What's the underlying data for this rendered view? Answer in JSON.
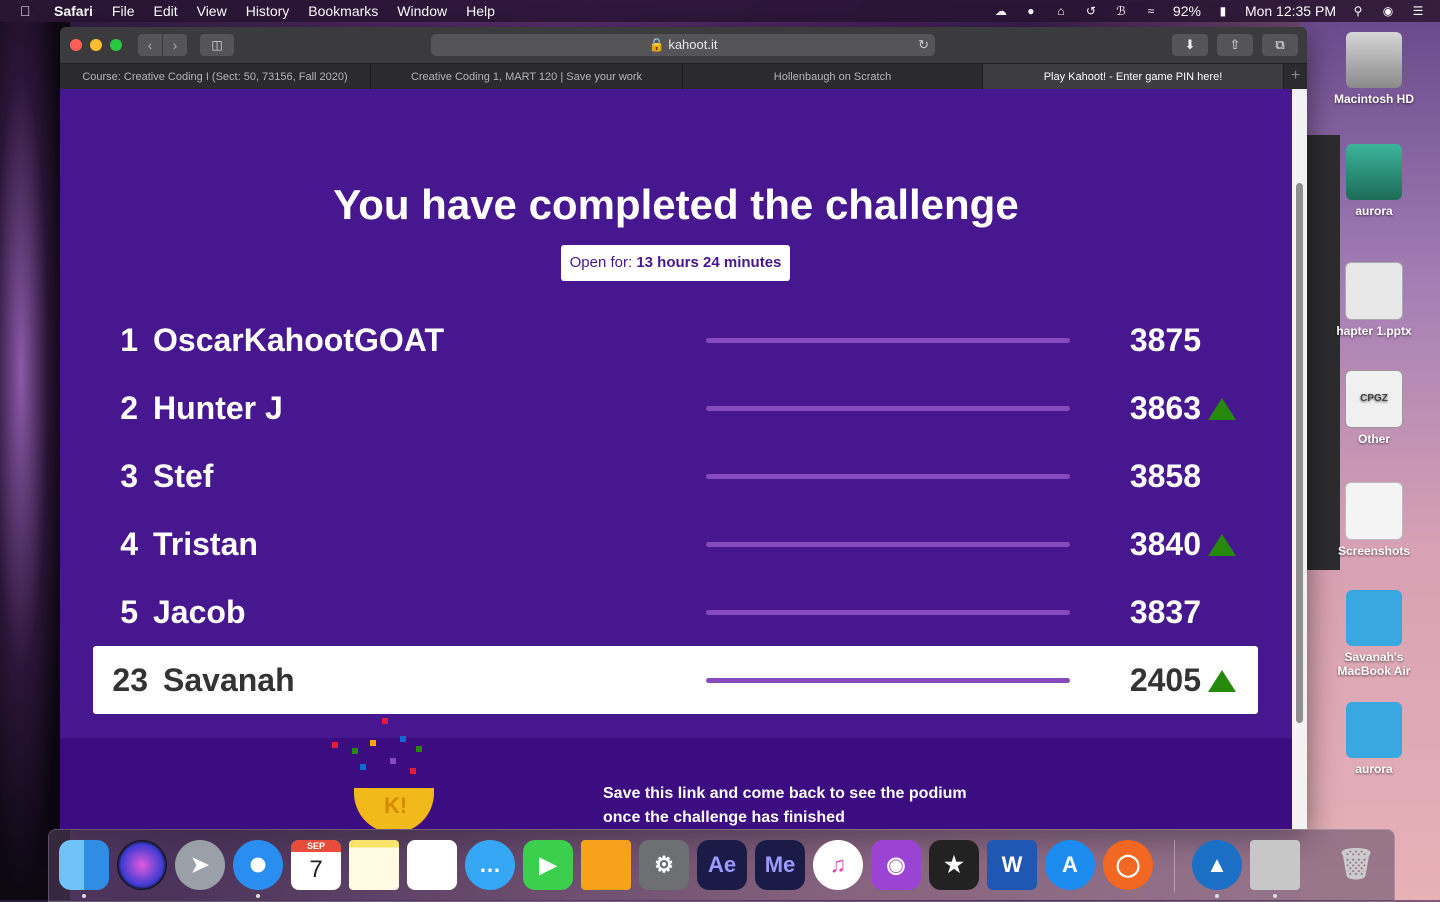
{
  "menubar": {
    "apple": "",
    "items": [
      "Safari",
      "File",
      "Edit",
      "View",
      "History",
      "Bookmarks",
      "Window",
      "Help"
    ],
    "battery": "92%",
    "clock": "Mon 12:35 PM"
  },
  "browser": {
    "url": "kahoot.it",
    "tabs": [
      "Course: Creative Coding I (Sect: 50, 73156, Fall 2020)",
      "Creative Coding 1, MART 120 | Save your work",
      "Hollenbaugh on Scratch",
      "Play Kahoot! - Enter game PIN here!"
    ],
    "active_tab": 3
  },
  "page": {
    "heading": "You have completed the challenge",
    "open_for_label": "Open for:",
    "open_for_value": "13 hours 24 minutes",
    "leaderboard": [
      {
        "rank": "1",
        "name": "OscarKahootGOAT",
        "score": "3875",
        "up": false
      },
      {
        "rank": "2",
        "name": "Hunter J",
        "score": "3863",
        "up": true
      },
      {
        "rank": "3",
        "name": "Stef",
        "score": "3858",
        "up": false
      },
      {
        "rank": "4",
        "name": "Tristan",
        "score": "3840",
        "up": true
      },
      {
        "rank": "5",
        "name": "Jacob",
        "score": "3837",
        "up": false
      },
      {
        "rank": "23",
        "name": "Savanah",
        "score": "2405",
        "up": true
      }
    ],
    "footer_line1": "Save this link and come back to see the podium",
    "footer_line2": "once the challenge has finished"
  },
  "desktop": {
    "icons": [
      "Macintosh HD",
      "aurora",
      "hapter 1.pptx",
      "Other",
      "Screenshots",
      "Savanah's MacBook Air",
      "aurora"
    ],
    "cpgz_label": "CPGZ"
  },
  "dock": {
    "apps": [
      "Finder",
      "Siri",
      "Launchpad",
      "Safari",
      "Calendar",
      "Notes",
      "Reminders",
      "Messages",
      "FaceTime",
      "Pages",
      "System Preferences",
      "After Effects",
      "Media Encoder",
      "iTunes",
      "Podcasts",
      "Final Cut Pro",
      "Word",
      "App Store",
      "Origin",
      "Mountain",
      "Preview",
      "Trash"
    ],
    "calendar_month": "SEP",
    "calendar_day": "7",
    "ae_label": "Ae",
    "me_label": "Me",
    "word_label": "W"
  },
  "colors": {
    "page_bg": "#46178f",
    "footer_bg": "#3c0d80",
    "bar": "#864cbf",
    "up_arrow": "#26890c"
  }
}
